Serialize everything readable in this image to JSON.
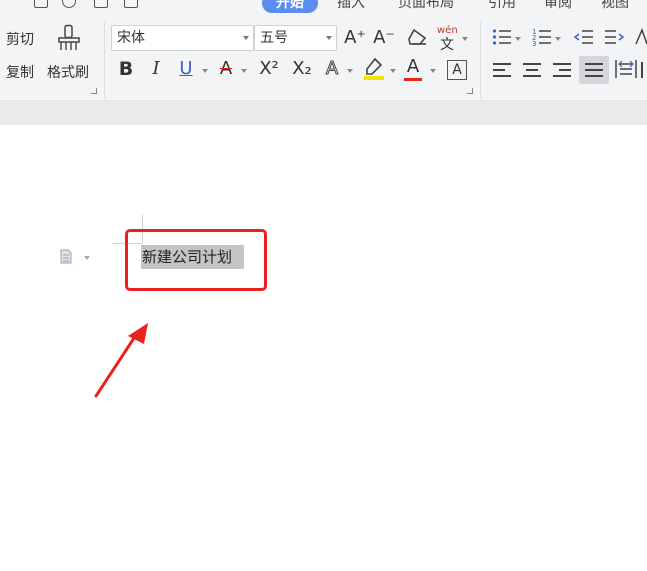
{
  "tabs": [
    {
      "label": "开始",
      "active": true
    },
    {
      "label": "插入",
      "active": false
    },
    {
      "label": "页面布局",
      "active": false
    },
    {
      "label": "引用",
      "active": false
    },
    {
      "label": "审阅",
      "active": false
    },
    {
      "label": "视图",
      "active": false
    }
  ],
  "clipboard": {
    "cut_label": "剪切",
    "copy_label": "复制",
    "format_painter_label": "格式刷"
  },
  "font": {
    "family_value": "宋体",
    "size_value": "五号",
    "grow_label": "A⁺",
    "shrink_label": "A⁻",
    "phonetic_label": "wén",
    "bold_label": "B",
    "italic_label": "I",
    "underline_label": "U",
    "strike_label": "A",
    "superscript_label": "X²",
    "subscript_label": "X₂",
    "text_effect_label": "A",
    "font_color_label": "A",
    "char_border_label": "A"
  },
  "colors": {
    "accent": "#5b8def",
    "highlight_yellow": "#f5e400",
    "font_color_red": "#e8221f",
    "annotation_red": "#e8221f",
    "selection_gray": "#c4c4c4"
  },
  "document": {
    "selected_text": "新建公司计划"
  }
}
